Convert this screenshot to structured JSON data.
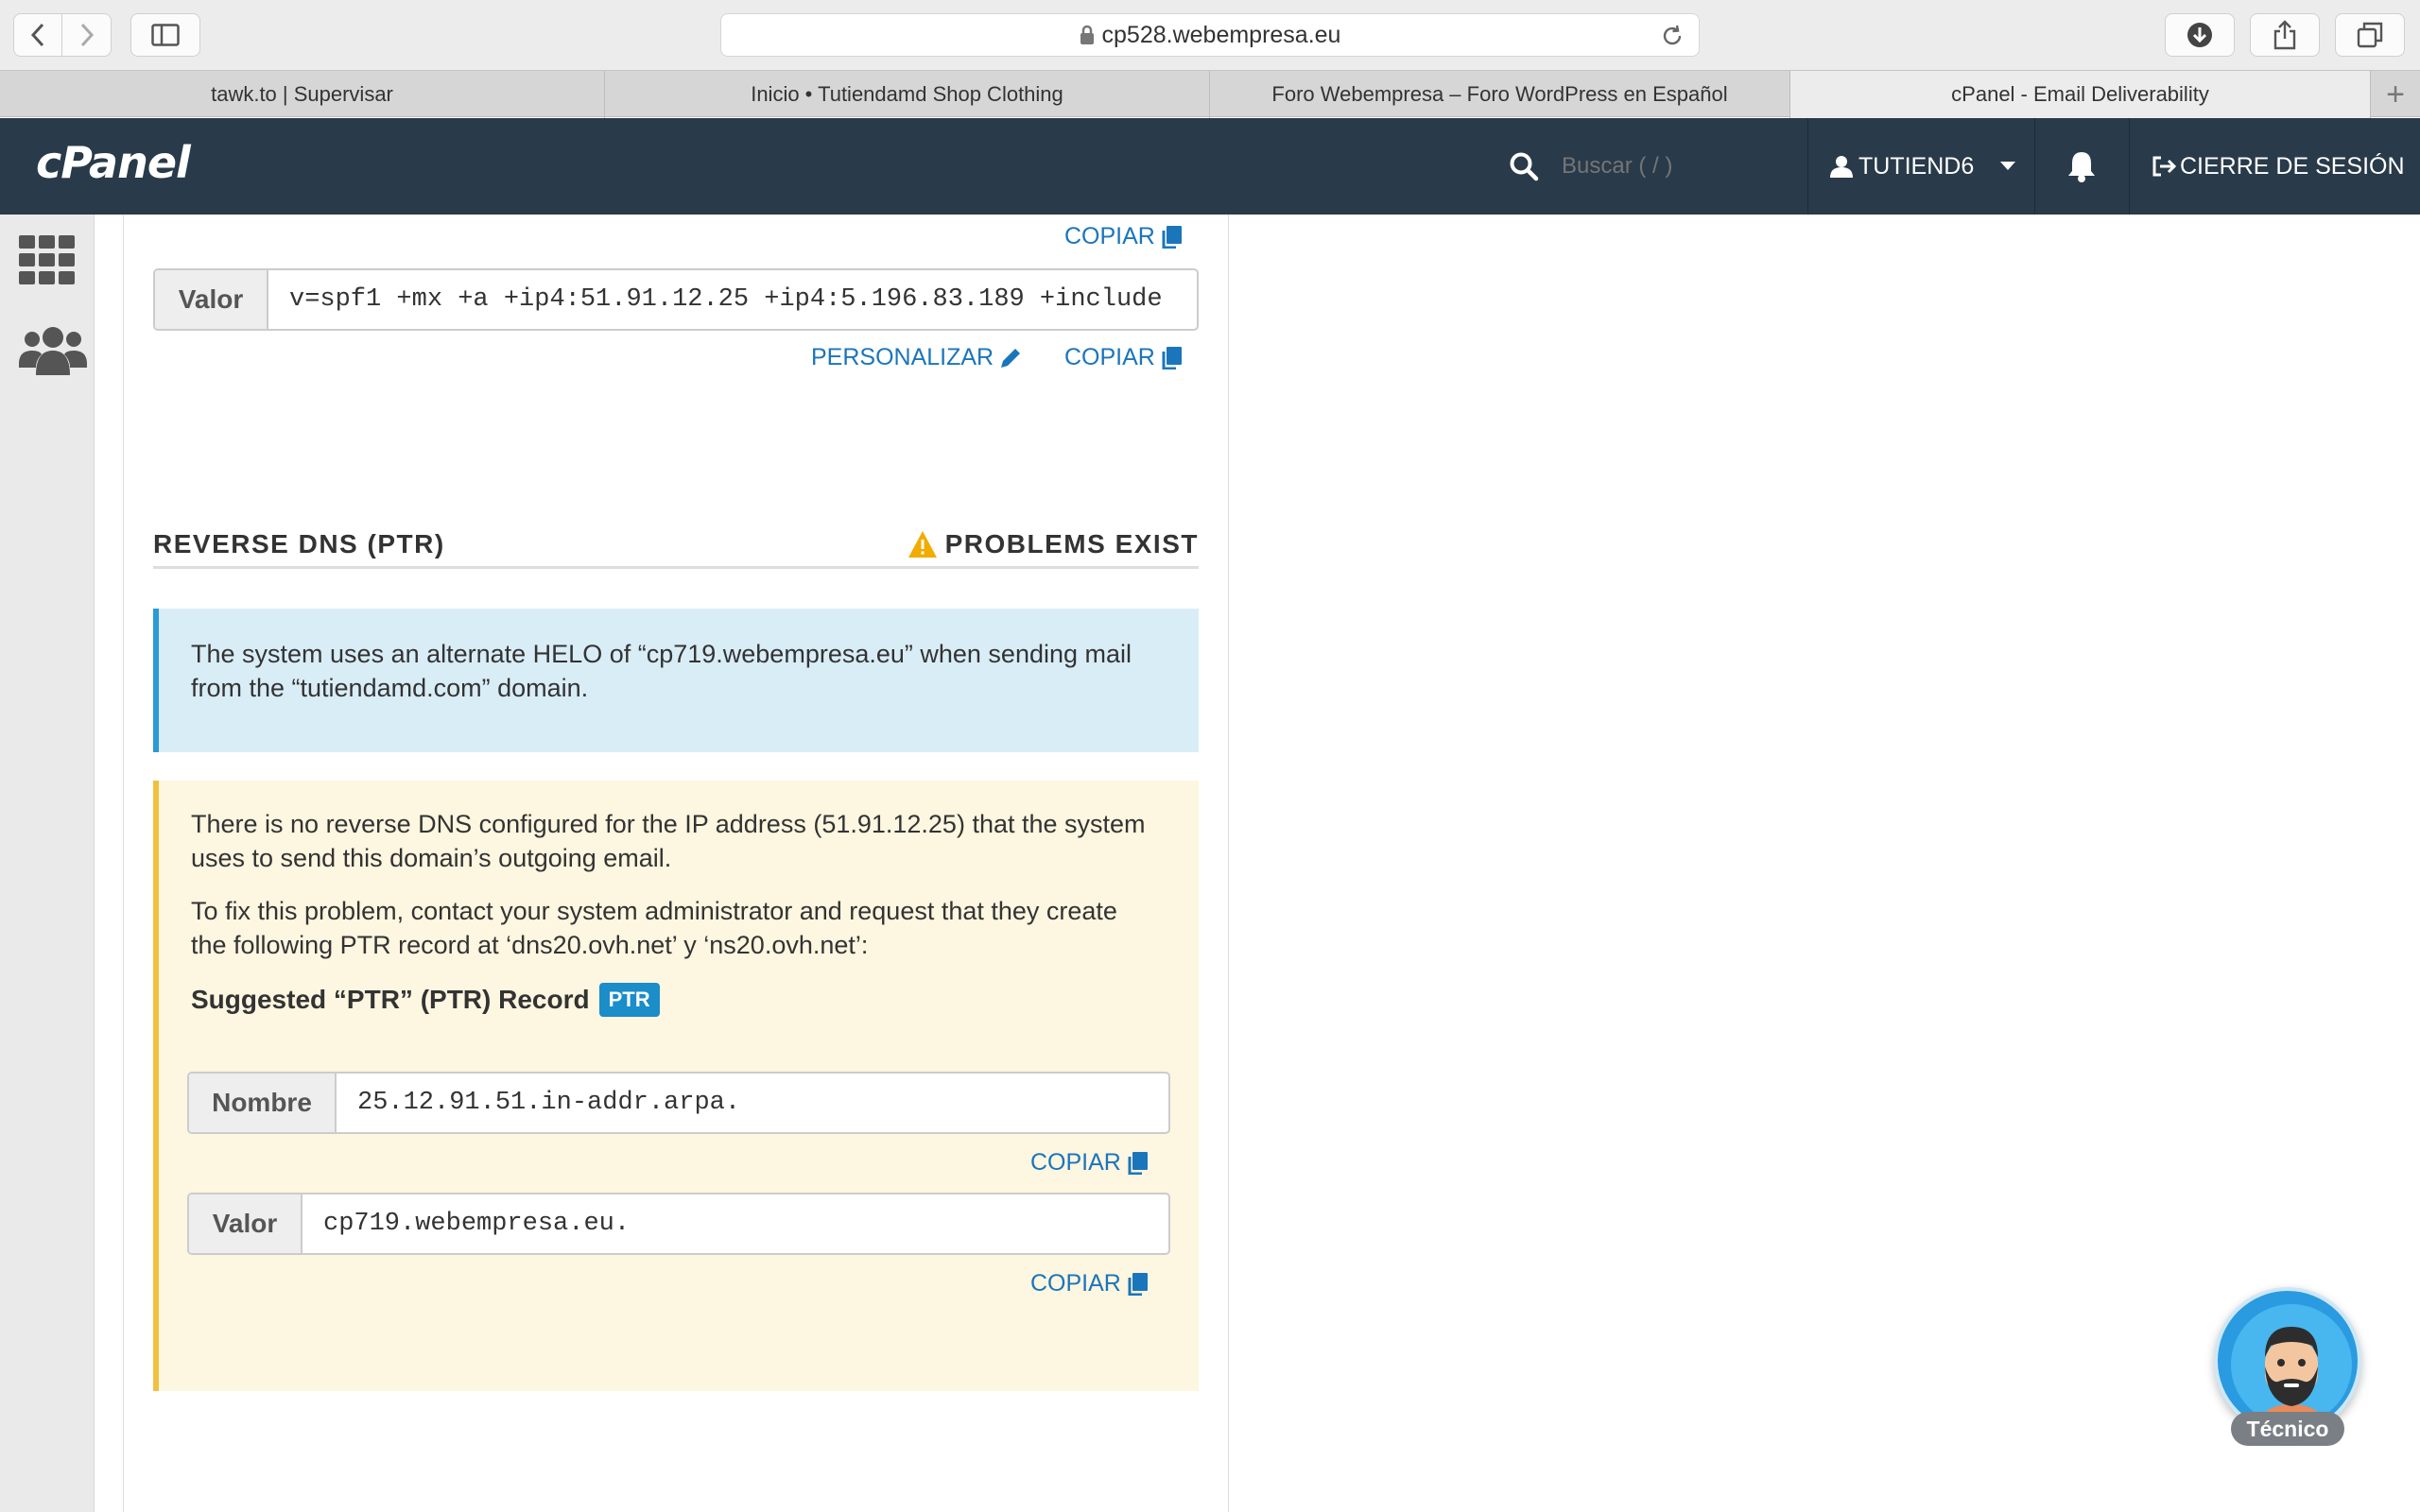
{
  "browser": {
    "url": "cp528.webempresa.eu",
    "tabs": [
      {
        "label": "tawk.to | Supervisar"
      },
      {
        "label": "Inicio • Tutiendamd Shop Clothing"
      },
      {
        "label": "Foro Webempresa – Foro WordPress en Español"
      },
      {
        "label": "cPanel - Email Deliverability",
        "active": true
      }
    ],
    "new_tab": "+"
  },
  "header": {
    "logo": "cPanel",
    "search_placeholder": "Buscar ( / )",
    "username": "TUTIEND6",
    "logout_label": "CIERRE DE SESIÓN"
  },
  "spf": {
    "copy_top_label": "COPIAR",
    "value_label": "Valor",
    "value": "v=spf1 +mx +a +ip4:51.91.12.25 +ip4:5.196.83.189 +include",
    "customize_label": "PERSONALIZAR",
    "copy_label": "COPIAR"
  },
  "reverse_dns": {
    "title": "REVERSE DNS (PTR)",
    "status": "PROBLEMS EXIST",
    "status_color": "#f0ad00",
    "info": "The system uses an alternate HELO of “cp719.webempresa.eu” when sending mail from the “tutiendamd.com” domain.",
    "warning_p1": "There is no reverse DNS configured for the IP address (51.91.12.25) that the system uses to send this domain’s outgoing email.",
    "warning_p2": "To fix this problem, contact your system administrator and request that they create the following PTR record at ‘dns20.ovh.net’ y ‘ns20.ovh.net’:",
    "suggested_title": "Suggested “PTR” (PTR) Record",
    "badge": "PTR",
    "name_label": "Nombre",
    "name_value": "25.12.91.51.in-addr.arpa.",
    "copy_name_label": "COPIAR",
    "value_label": "Valor",
    "value_value": "cp719.webempresa.eu.",
    "copy_value_label": "COPIAR"
  },
  "chat_widget": {
    "label": "Técnico"
  }
}
